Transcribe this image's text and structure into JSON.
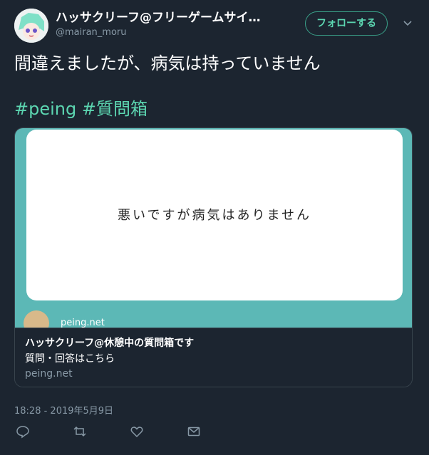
{
  "user": {
    "display_name": "ハッサクリーフ@フリーゲームサイ…",
    "screen_name": "@mairan_moru",
    "follow_label": "フォローする"
  },
  "tweet": {
    "text": "間違えましたが、病気は持っていません",
    "hashtags": [
      "#peing",
      "#質問箱"
    ],
    "timestamp": "18:28 - 2019年5月9日"
  },
  "card": {
    "image_text": "悪いですが病気はありません",
    "image_domain": "peing.net",
    "title": "ハッサクリーフ@休憩中の質問箱です",
    "description": "質問・回答はこちら",
    "domain": "peing.net"
  },
  "icons": {
    "reply": "reply-icon",
    "retweet": "retweet-icon",
    "like": "heart-icon",
    "dm": "mail-icon",
    "more": "chevron-down-icon"
  },
  "colors": {
    "background": "#1c2530",
    "accent": "#5cd6b1",
    "muted": "#8899a6",
    "card_teal": "#5cb8b6"
  }
}
